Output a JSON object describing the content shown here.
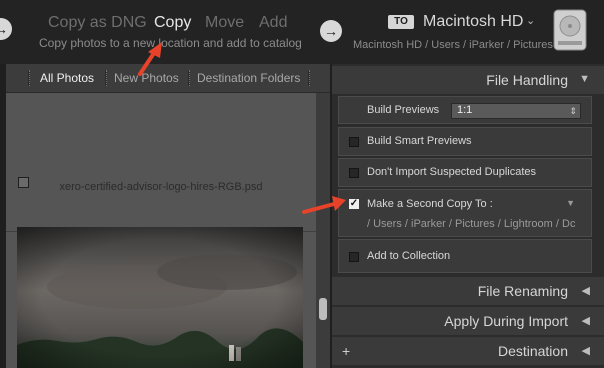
{
  "topbar": {
    "modes": [
      "Copy as DNG",
      "Copy",
      "Move",
      "Add"
    ],
    "active_mode": "Copy",
    "mode_description": "Copy photos to a new location and add to catalog",
    "to_badge": "TO",
    "destination_name": "Macintosh HD",
    "destination_chevron": "⌄",
    "destination_path": "Macintosh HD / Users / iParker / Pictures",
    "drive_icon": "hard-drive-icon",
    "left_arrow_icon": "→",
    "mid_arrow_icon": "→"
  },
  "tabs": [
    "All Photos",
    "New Photos",
    "Destination Folders"
  ],
  "grid": {
    "filename": "xero-certified-advisor-logo-hires-RGB.psd"
  },
  "file_handling": {
    "title": "File Handling",
    "build_previews_label": "Build Previews",
    "build_previews_value": "1:1",
    "build_smart_previews_label": "Build Smart Previews",
    "dont_import_label": "Don't Import Suspected Duplicates",
    "second_copy_label": "Make a Second Copy To :",
    "second_copy_check": "✓",
    "second_copy_path": "/ Users / iParker / Pictures / Lightroom / Dc",
    "add_to_collection_label": "Add to Collection"
  },
  "sections": {
    "file_renaming": "File Renaming",
    "apply_during_import": "Apply During Import",
    "destination": "Destination"
  },
  "colors": {
    "annotation_arrow": "#e8432a",
    "panel_bg": "#2c2c2c",
    "header_bg": "#3a3a3a"
  }
}
